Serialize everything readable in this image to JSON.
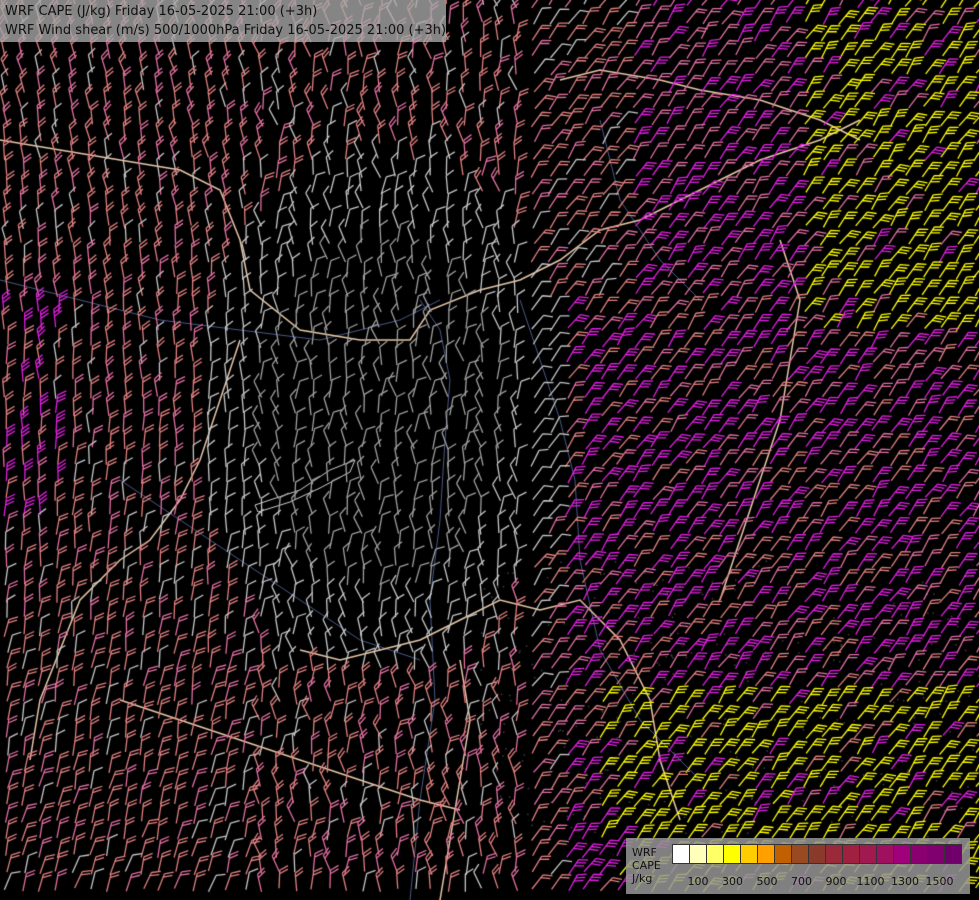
{
  "header": {
    "title_line_1": "WRF CAPE (J/kg) Friday 16-05-2025 21:00 (+3h)",
    "title_line_2": "WRF Wind shear (m/s) 500/1000hPa Friday 16-05-2025 21:00 (+3h)"
  },
  "legend": {
    "model": "WRF",
    "variable": "CAPE",
    "unit": "J/kg",
    "swatch_colors": [
      "#ffffff",
      "#ffffbb",
      "#ffff66",
      "#ffff00",
      "#ffcc00",
      "#ffa000",
      "#c06000",
      "#9a4a20",
      "#8a3a2a",
      "#9a2a3a",
      "#a02040",
      "#a01a50",
      "#a01060",
      "#a0007a",
      "#8a0070",
      "#800070",
      "#70006a"
    ],
    "tick_labels": [
      "100",
      "300",
      "500",
      "700",
      "900",
      "1100",
      "1300",
      "1500"
    ]
  },
  "map": {
    "background": "#000000",
    "border_color": "#e8c8a8",
    "river_color": "#4a5a8a",
    "barb_colors": {
      "light_gray": "#c8c8c8",
      "gray": "#a0a0a0",
      "salmon": "#e08080",
      "pink": "#e070a0",
      "magenta": "#e020e0",
      "yellow": "#ffff00"
    }
  }
}
